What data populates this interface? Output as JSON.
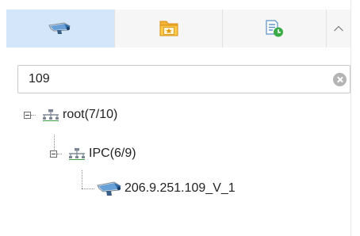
{
  "tabs": [
    {
      "name": "camera-tab",
      "icon": "camera-icon",
      "active": true
    },
    {
      "name": "favorites-tab",
      "icon": "favorite-folder-icon",
      "active": false
    },
    {
      "name": "schedule-tab",
      "icon": "schedule-list-icon",
      "active": false
    }
  ],
  "collapse_icon": "chevron-up-icon",
  "search": {
    "value": "109",
    "placeholder": ""
  },
  "tree": {
    "root": {
      "label": "root(7/10)",
      "icon": "network-icon",
      "expanded": true
    },
    "group": {
      "label": "IPC(6/9)",
      "icon": "network-icon",
      "expanded": true
    },
    "device": {
      "label": "206.9.251.109_V_1",
      "icon": "camera-icon"
    }
  },
  "colors": {
    "active_tab": "#d3e6fa",
    "tab_bar": "#f6f6f6",
    "folder": "#f5b335",
    "schedule_green": "#3aab47",
    "camera_blue": "#4e92d2"
  }
}
